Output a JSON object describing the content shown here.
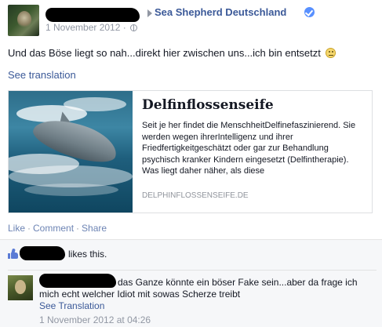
{
  "post": {
    "page_name": "Sea Shepherd Deutschland",
    "date": "1 November 2012",
    "meta_separator": "·",
    "text": "Und das Böse liegt so nah...direkt hier zwischen uns...ich bin entsetzt",
    "see_translation": "See translation"
  },
  "link_preview": {
    "title": "Delfinflossenseife",
    "description": "Seit je her findet die MenschheitDelfinefaszinierend. Sie werden wegen ihrerIntelligenz und ihrer Friedfertigkeitgeschätzt oder gar zur Behandlung psychisch kranker Kindern eingesetzt (Delfintherapie). Was liegt daher näher, als diese",
    "domain": "DELPHINFLOSSENSEIFE.DE"
  },
  "actions": {
    "like": "Like",
    "comment": "Comment",
    "share": "Share",
    "separator": "·"
  },
  "likes": {
    "text": "likes this."
  },
  "comment": {
    "text": "das Ganze könnte ein böser Fake sein...aber da frage ich mich echt welcher Idiot mit sowas Scherze treibt",
    "see_translation": "See Translation",
    "timestamp": "1 November 2012 at 04:26"
  },
  "icons": {
    "arrow": "right-arrow-icon",
    "verified": "verified-badge-icon",
    "audience": "globe-icon",
    "emoji": "smiley-icon",
    "like": "thumbs-up-icon"
  },
  "colors": {
    "link": "#3b5998",
    "muted": "#9197a3",
    "verified": "#5890ff",
    "ufi_background": "#f6f7f9"
  }
}
